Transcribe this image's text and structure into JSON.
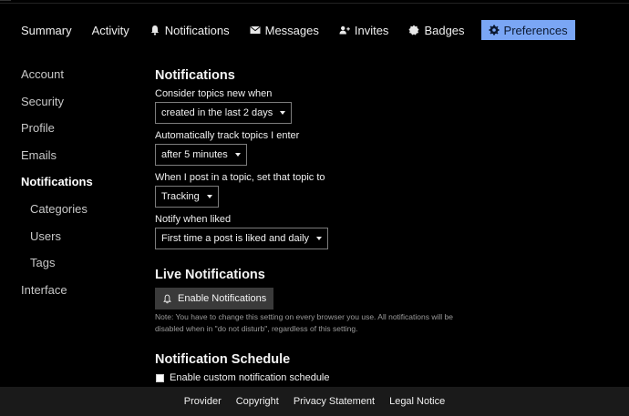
{
  "nav": {
    "summary": "Summary",
    "activity": "Activity",
    "notifications": "Notifications",
    "messages": "Messages",
    "invites": "Invites",
    "badges": "Badges",
    "preferences": "Preferences"
  },
  "sidebar": {
    "items": [
      {
        "label": "Account"
      },
      {
        "label": "Security"
      },
      {
        "label": "Profile"
      },
      {
        "label": "Emails"
      },
      {
        "label": "Notifications"
      },
      {
        "label": "Categories"
      },
      {
        "label": "Users"
      },
      {
        "label": "Tags"
      },
      {
        "label": "Interface"
      }
    ]
  },
  "notifications": {
    "title": "Notifications",
    "new_topics_label": "Consider topics new when",
    "new_topics_value": "created in the last 2 days",
    "track_label": "Automatically track topics I enter",
    "track_value": "after 5 minutes",
    "post_label": "When I post in a topic, set that topic to",
    "post_value": "Tracking",
    "liked_label": "Notify when liked",
    "liked_value": "First time a post is liked and daily"
  },
  "live": {
    "title": "Live Notifications",
    "button": "Enable Notifications",
    "note": "Note: You have to change this setting on every browser you use. All notifications will be disabled when in \"do not disturb\", regardless of this setting."
  },
  "schedule": {
    "title": "Notification Schedule",
    "checkbox_label": "Enable custom notification schedule",
    "checked": false
  },
  "footer": {
    "provider": "Provider",
    "copyright": "Copyright",
    "privacy": "Privacy Statement",
    "legal": "Legal Notice"
  },
  "colors": {
    "active_tab": "#7aa6f5",
    "footer_bg": "#1a1a1a",
    "button_bg": "#3a3a3a"
  }
}
